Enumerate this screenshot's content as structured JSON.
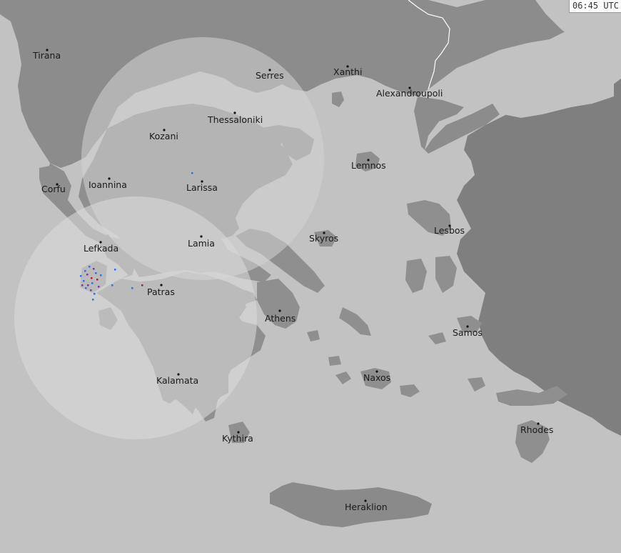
{
  "timestamp": "06:45 UTC",
  "colors": {
    "sea": "#c2c2c2",
    "land": "#8f8f8f",
    "land_dark": "#7a7a7a",
    "radar_inner": "#a8a8a8",
    "radar_coverage": "#d6d6d6",
    "border": "#ffffff",
    "strike_blue": "#2f6fe0",
    "strike_purple": "#8a2ab0",
    "strike_red": "#c0103a"
  },
  "cities": [
    {
      "name": "Tirana",
      "id": "tirana"
    },
    {
      "name": "Serres",
      "id": "serres"
    },
    {
      "name": "Xanthi",
      "id": "xanthi"
    },
    {
      "name": "Alexandroupoli",
      "id": "alexandroupoli"
    },
    {
      "name": "Thessaloniki",
      "id": "thessaloniki"
    },
    {
      "name": "Kozani",
      "id": "kozani"
    },
    {
      "name": "Lemnos",
      "id": "lemnos"
    },
    {
      "name": "Corfu",
      "id": "corfu"
    },
    {
      "name": "Ioannina",
      "id": "ioannina"
    },
    {
      "name": "Larissa",
      "id": "larissa"
    },
    {
      "name": "Lesbos",
      "id": "lesbos"
    },
    {
      "name": "Skyros",
      "id": "skyros"
    },
    {
      "name": "Lefkada",
      "id": "lefkada"
    },
    {
      "name": "Lamia",
      "id": "lamia"
    },
    {
      "name": "Patras",
      "id": "patras"
    },
    {
      "name": "Athens",
      "id": "athens"
    },
    {
      "name": "Samos",
      "id": "samos"
    },
    {
      "name": "Naxos",
      "id": "naxos"
    },
    {
      "name": "Kalamata",
      "id": "kalamata"
    },
    {
      "name": "Rhodes",
      "id": "rhodes"
    },
    {
      "name": "Kythira",
      "id": "kythira"
    },
    {
      "name": "Heraklion",
      "id": "heraklion"
    }
  ]
}
